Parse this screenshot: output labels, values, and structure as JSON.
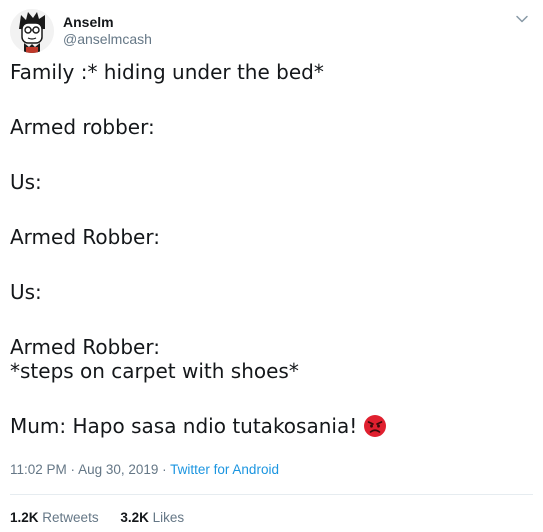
{
  "author": {
    "display_name": "Anselm",
    "handle": "@anselmcash"
  },
  "tweet": {
    "lines": [
      "Family :* hiding under the bed*",
      "Armed robber:",
      "Us:",
      "Armed Robber:",
      "Us:",
      "Armed Robber:",
      "*steps on carpet with shoes*",
      "Mum: Hapo sasa ndio tutakosania!"
    ],
    "emoji": "angry-face-icon"
  },
  "meta": {
    "time": "11:02 PM",
    "separator": " · ",
    "date": "Aug 30, 2019",
    "source": "Twitter for Android"
  },
  "stats": {
    "retweets_count": "1.2K",
    "retweets_label": "Retweets",
    "likes_count": "3.2K",
    "likes_label": "Likes"
  },
  "colors": {
    "link": "#1b95e0",
    "secondary_text": "#657786",
    "primary_text": "#14171a",
    "emoji": "#e0202f"
  }
}
